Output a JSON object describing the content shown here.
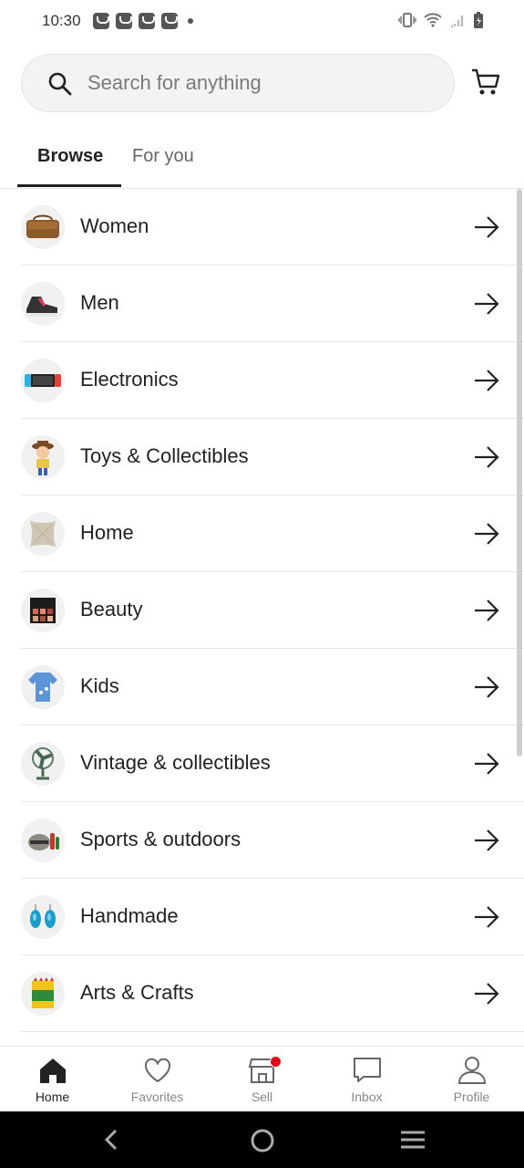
{
  "status_bar": {
    "time": "10:30",
    "icons": [
      "mercari-notification-icon",
      "mercari-notification-icon",
      "mercari-notification-icon",
      "mercari-notification-icon",
      "dot-icon",
      "vibrate-icon",
      "wifi-icon",
      "signal-icon",
      "battery-charging-icon"
    ]
  },
  "search": {
    "placeholder": "Search for anything",
    "icon": "search-icon"
  },
  "header": {
    "cart_icon": "cart-icon"
  },
  "tabs": [
    {
      "label": "Browse",
      "active": true
    },
    {
      "label": "For you",
      "active": false
    }
  ],
  "categories": [
    {
      "label": "Women",
      "icon": "handbag-icon"
    },
    {
      "label": "Men",
      "icon": "sneaker-icon"
    },
    {
      "label": "Electronics",
      "icon": "game-console-icon"
    },
    {
      "label": "Toys & Collectibles",
      "icon": "toy-figure-icon"
    },
    {
      "label": "Home",
      "icon": "pillow-icon"
    },
    {
      "label": "Beauty",
      "icon": "makeup-palette-icon"
    },
    {
      "label": "Kids",
      "icon": "kids-dress-icon"
    },
    {
      "label": "Vintage & collectibles",
      "icon": "vintage-fan-icon"
    },
    {
      "label": "Sports & outdoors",
      "icon": "sports-gear-icon"
    },
    {
      "label": "Handmade",
      "icon": "earrings-icon"
    },
    {
      "label": "Arts & Crafts",
      "icon": "crayons-icon"
    }
  ],
  "bottom_nav": [
    {
      "label": "Home",
      "icon": "home-icon",
      "active": true
    },
    {
      "label": "Favorites",
      "icon": "heart-icon",
      "active": false
    },
    {
      "label": "Sell",
      "icon": "store-icon",
      "active": false,
      "badge": true
    },
    {
      "label": "Inbox",
      "icon": "message-icon",
      "active": false
    },
    {
      "label": "Profile",
      "icon": "person-icon",
      "active": false
    }
  ],
  "colors": {
    "text": "#222222",
    "muted": "#888888",
    "divider": "#e6e6e6",
    "badge": "#e0091c"
  }
}
